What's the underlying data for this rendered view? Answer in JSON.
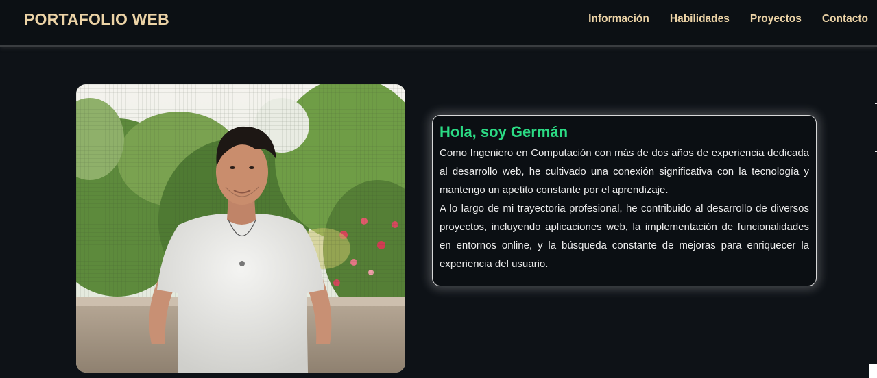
{
  "header": {
    "brand": "PORTAFOLIO WEB",
    "nav": [
      {
        "label": "Información"
      },
      {
        "label": "Habilidades"
      },
      {
        "label": "Proyectos"
      },
      {
        "label": "Contacto"
      }
    ]
  },
  "hero": {
    "photo_subject": "portrait-photo",
    "greeting": "Hola, soy Germán",
    "bio_paragraph_1": "Como Ingeniero en Computación con más de dos años de experiencia dedicada al desarrollo web, he cultivado una conexión significativa con la tecnología y mantengo un apetito constante por el aprendizaje.",
    "bio_paragraph_2": "A lo largo de mi trayectoria profesional, he contribuido al desarrollo de diversos proyectos, incluyendo aplicaciones web, la implementación de funcionalidades en entornos online, y la búsqueda constante de mejoras para enriquecer la experiencia del usuario."
  },
  "colors": {
    "background": "#0e1217",
    "accent_brand": "#ecd3a6",
    "greeting_green": "#2bdb84",
    "text": "#ececec"
  }
}
